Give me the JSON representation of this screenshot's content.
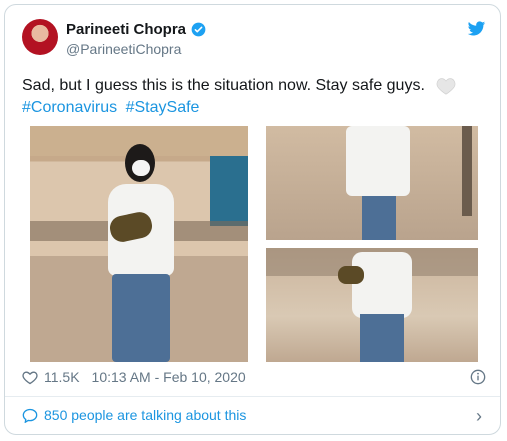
{
  "tweet": {
    "author_name": "Parineeti Chopra",
    "handle": "@ParineetiChopra",
    "text": "Sad, but I guess this is the situation now. Stay safe guys.",
    "hashtags": [
      "#Coronavirus",
      "#StaySafe"
    ],
    "likes": "11.5K",
    "timestamp": "10:13 AM - Feb 10, 2020",
    "talking": "850 people are talking about this"
  },
  "colors": {
    "link": "#1b95e0",
    "muted": "#657786",
    "text": "#14171a",
    "verified": "#1da1f2"
  },
  "icons": {
    "verified": "verified-badge-icon",
    "bird": "twitter-bird-icon",
    "heart": "heart-icon",
    "info": "info-icon",
    "comment": "comment-bubble-icon",
    "chevron": "chevron-right-icon"
  }
}
